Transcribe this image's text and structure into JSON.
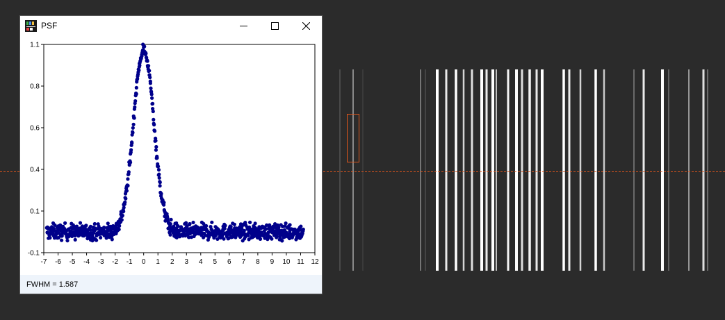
{
  "window": {
    "title": "PSF",
    "icon": "chart-app-icon",
    "controls": [
      "minimize-icon",
      "maximize-icon",
      "close-icon"
    ]
  },
  "status": {
    "fwhm_text": "FWHM = 1.587"
  },
  "background": {
    "colors": {
      "background": "#2b2b2b",
      "guide_line": "#e0561c",
      "selection_box": "#e0561c",
      "spectral_lines": "#ffffff"
    }
  },
  "chart_data": {
    "type": "scatter",
    "title": "",
    "xlabel": "",
    "ylabel": "",
    "xlim": [
      -7,
      12
    ],
    "ylim": [
      -0.1,
      1.1
    ],
    "x_ticks": [
      -7,
      -6,
      -5,
      -4,
      -3,
      -2,
      -1,
      0,
      1,
      2,
      3,
      4,
      5,
      6,
      7,
      8,
      9,
      10,
      11,
      12
    ],
    "y_ticks": [
      "1.1",
      "0.8",
      "0.6",
      "0.4",
      "0.1",
      "-0.1"
    ],
    "marker_color": "#00008b",
    "profile": {
      "description": "point cloud",
      "peak_x": 0.0,
      "peak_y": 1.1,
      "fwhm": 1.587,
      "baseline_y": 0.0,
      "x_range": [
        -6.8,
        11.2
      ]
    }
  }
}
